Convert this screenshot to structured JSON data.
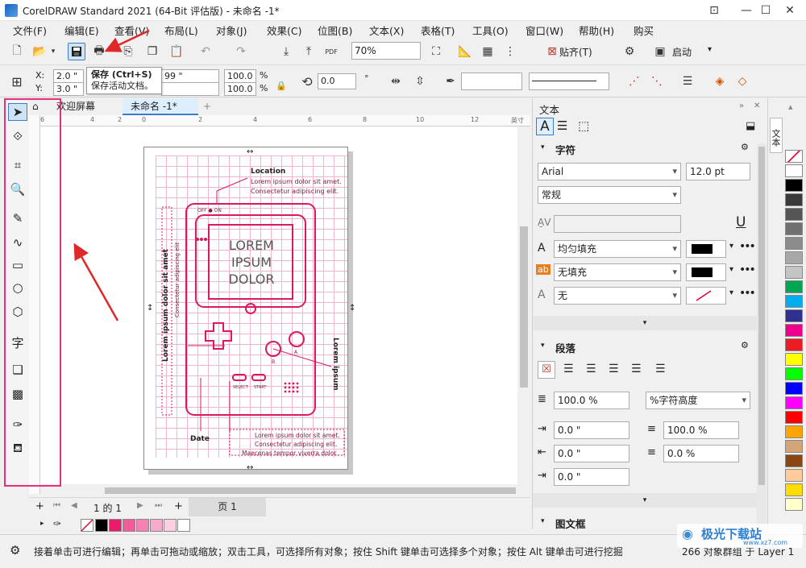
{
  "app": {
    "title": "CorelDRAW Standard 2021 (64-Bit 评估版) - 未命名 -1*"
  },
  "menu": [
    "文件(F)",
    "编辑(E)",
    "查看(V)",
    "布局(L)",
    "对象(J)",
    "效果(C)",
    "位图(B)",
    "文本(X)",
    "表格(T)",
    "工具(O)",
    "窗口(W)",
    "帮助(H)",
    "购买"
  ],
  "toolbar": {
    "zoom_value": "70%",
    "snap_label": "贴齐(T)",
    "launch_label": "启动"
  },
  "tooltip": {
    "title": "保存 (Ctrl+S)",
    "desc": "保存活动文档。"
  },
  "props": {
    "x_label": "X:",
    "x_value": "2.0 \"",
    "y_label": "Y:",
    "y_value": "3.0 \"",
    "w_value": "99 \"",
    "scale_x": "100.0",
    "scale_y": "100.0",
    "pct": "%",
    "angle": "0.0"
  },
  "doc_tabs": [
    "欢迎屏幕",
    "未命名 -1*"
  ],
  "ruler": {
    "h_ticks": [
      "6",
      "4",
      "2",
      "0",
      "2",
      "4",
      "6",
      "8",
      "10",
      "12"
    ],
    "h_unit": "英寸"
  },
  "artwork": {
    "location_title": "Location",
    "lorem1": "Lorem ipsum dolor sit amet.",
    "lorem2": "Consectetur adipiscing elit.",
    "off_on": "OFF ● ON",
    "screen_l1": "LOREM",
    "screen_l2": "IPSUM",
    "screen_l3": "DOLOR",
    "vertical_left": "Lorem ipsum dolor sit amet",
    "vertical_left2": "Consectetur adipiscing elit",
    "vertical_right": "Lorem ipsum",
    "btn_a": "A",
    "btn_b": "B",
    "select": "SELECT",
    "start": "START",
    "date_title": "Date",
    "bottom1": "Lorem ipsum dolor sit amet.",
    "bottom2": "Consectetur adipiscing elit.",
    "bottom3": "Maecenas tempor viverra dolor."
  },
  "pagebar": {
    "page_count": "1 的 1",
    "page_tab": "页 1"
  },
  "docker": {
    "title": "文本",
    "char_section": "字符",
    "font_name": "Arial",
    "font_size": "12.0 pt",
    "font_style": "常规",
    "fill1": "均匀填充",
    "fill2": "无填充",
    "fill3": "无",
    "para_section": "段落",
    "line_spacing": "100.0 %",
    "line_spacing_unit": "%字符高度",
    "indent1": "0.0 \"",
    "indent2": "100.0 %",
    "indent3": "0.0 \"",
    "indent4": "0.0 %",
    "indent5": "0.0 \"",
    "frame_section": "图文框"
  },
  "sidetab_label": "文本",
  "palette_colors": [
    "#ffffff",
    "#000000",
    "#3a3a3a",
    "#555555",
    "#707070",
    "#8c8c8c",
    "#a8a8a8",
    "#c4c4c4",
    "#00a651",
    "#00aeef",
    "#2e3192",
    "#ec008c",
    "#ed1c24",
    "#ffff00",
    "#00ff00",
    "#0000ff",
    "#ff00ff",
    "#ff0000",
    "#ffa500",
    "#d2a679",
    "#8b4513",
    "#ffcc99",
    "#ffdd00",
    "#ffffcc"
  ],
  "bottom_swatches": [
    "#000000",
    "#ec1a6b",
    "#f25c9a",
    "#f582b3",
    "#f8aacb",
    "#fbd1e2",
    "#ffffff"
  ],
  "status": {
    "hint": "接着单击可进行编辑；再单击可拖动或缩放；双击工具，可选择所有对象；按住 Shift 键单击可选择多个对象；按住 Alt 键单击可进行挖掘",
    "objects": "266 对象群组 于 Layer 1"
  },
  "watermark": {
    "name": "极光下载站",
    "url": "www.xz7.com"
  },
  "accent_color": "#e3317b"
}
